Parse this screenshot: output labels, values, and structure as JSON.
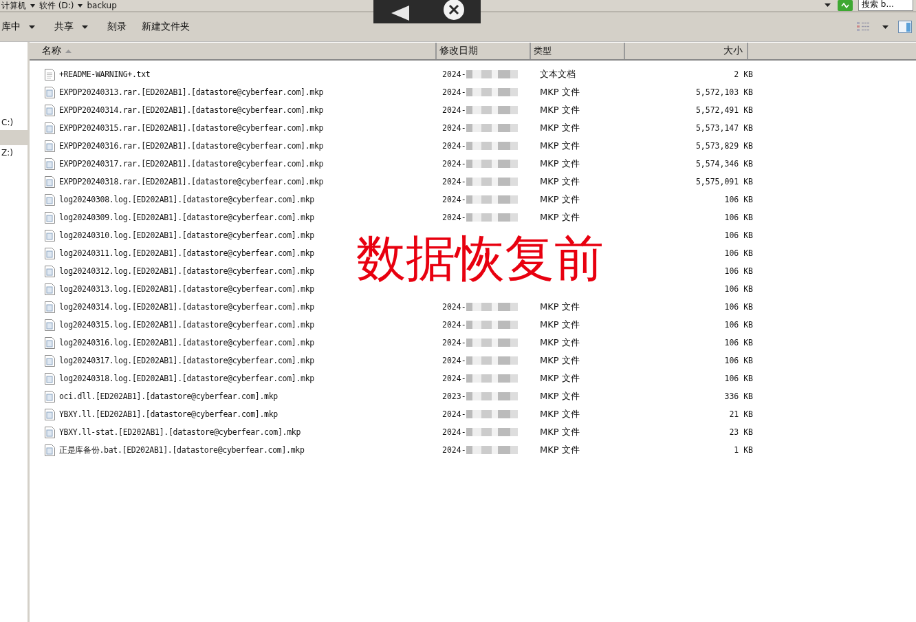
{
  "address_bar": {
    "crumbs": [
      "计算机",
      "软件 (D:)",
      "backup"
    ],
    "search": {
      "placeholder": "搜索 b..."
    }
  },
  "toolbar": {
    "items": [
      {
        "label": "库中",
        "dropdown": true
      },
      {
        "label": "共享",
        "dropdown": true
      },
      {
        "label": "刻录",
        "dropdown": false
      },
      {
        "label": "新建文件夹",
        "dropdown": false
      }
    ]
  },
  "sidebar": {
    "items": [
      {
        "label": "C:)",
        "selected": false
      },
      {
        "selected": true
      },
      {
        "label": "Z:)",
        "selected": false
      }
    ]
  },
  "table": {
    "columns": [
      {
        "label": "名称",
        "sorted": true
      },
      {
        "label": "修改日期",
        "sorted": false
      },
      {
        "label": "类型",
        "sorted": false
      },
      {
        "label": "大小",
        "sorted": false
      }
    ],
    "rows": [
      {
        "kind": "text",
        "name": "+README-WARNING+.txt",
        "date": "2024-",
        "type": "文本文档",
        "size": "2 KB"
      },
      {
        "kind": "file",
        "name": "EXPDP20240313.rar.[ED202AB1].[datastore@cyberfear.com].mkp",
        "date": "2024-",
        "type": "MKP 文件",
        "size": "5,572,103 KB"
      },
      {
        "kind": "file",
        "name": "EXPDP20240314.rar.[ED202AB1].[datastore@cyberfear.com].mkp",
        "date": "2024-",
        "type": "MKP 文件",
        "size": "5,572,491 KB"
      },
      {
        "kind": "file",
        "name": "EXPDP20240315.rar.[ED202AB1].[datastore@cyberfear.com].mkp",
        "date": "2024-",
        "type": "MKP 文件",
        "size": "5,573,147 KB"
      },
      {
        "kind": "file",
        "name": "EXPDP20240316.rar.[ED202AB1].[datastore@cyberfear.com].mkp",
        "date": "2024-",
        "type": "MKP 文件",
        "size": "5,573,829 KB"
      },
      {
        "kind": "file",
        "name": "EXPDP20240317.rar.[ED202AB1].[datastore@cyberfear.com].mkp",
        "date": "2024-",
        "type": "MKP 文件",
        "size": "5,574,346 KB"
      },
      {
        "kind": "file",
        "name": "EXPDP20240318.rar.[ED202AB1].[datastore@cyberfear.com].mkp",
        "date": "2024-",
        "type": "MKP 文件",
        "size": "5,575,091 KB"
      },
      {
        "kind": "file",
        "name": "log20240308.log.[ED202AB1].[datastore@cyberfear.com].mkp",
        "date": "2024-",
        "type": "MKP 文件",
        "size": "106 KB"
      },
      {
        "kind": "file",
        "name": "log20240309.log.[ED202AB1].[datastore@cyberfear.com].mkp",
        "date": "2024-",
        "type": "MKP 文件",
        "size": "106 KB"
      },
      {
        "kind": "file",
        "name": "log20240310.log.[ED202AB1].[datastore@cyberfear.com].mkp",
        "size": "106 KB"
      },
      {
        "kind": "file",
        "name": "log20240311.log.[ED202AB1].[datastore@cyberfear.com].mkp",
        "size": "106 KB"
      },
      {
        "kind": "file",
        "name": "log20240312.log.[ED202AB1].[datastore@cyberfear.com].mkp",
        "size": "106 KB"
      },
      {
        "kind": "file",
        "name": "log20240313.log.[ED202AB1].[datastore@cyberfear.com].mkp",
        "size": "106 KB"
      },
      {
        "kind": "file",
        "name": "log20240314.log.[ED202AB1].[datastore@cyberfear.com].mkp",
        "date": "2024-",
        "type": "MKP 文件",
        "size": "106 KB"
      },
      {
        "kind": "file",
        "name": "log20240315.log.[ED202AB1].[datastore@cyberfear.com].mkp",
        "date": "2024-",
        "type": "MKP 文件",
        "size": "106 KB"
      },
      {
        "kind": "file",
        "name": "log20240316.log.[ED202AB1].[datastore@cyberfear.com].mkp",
        "date": "2024-",
        "type": "MKP 文件",
        "size": "106 KB"
      },
      {
        "kind": "file",
        "name": "log20240317.log.[ED202AB1].[datastore@cyberfear.com].mkp",
        "date": "2024-",
        "type": "MKP 文件",
        "size": "106 KB"
      },
      {
        "kind": "file",
        "name": "log20240318.log.[ED202AB1].[datastore@cyberfear.com].mkp",
        "date": "2024-",
        "type": "MKP 文件",
        "size": "106 KB"
      },
      {
        "kind": "file",
        "name": "oci.dll.[ED202AB1].[datastore@cyberfear.com].mkp",
        "date": "2023-",
        "type": "MKP 文件",
        "size": "336 KB"
      },
      {
        "kind": "file",
        "name": "YBXY.ll.[ED202AB1].[datastore@cyberfear.com].mkp",
        "date": "2024-",
        "type": "MKP 文件",
        "size": "21 KB"
      },
      {
        "kind": "file",
        "name": "YBXY.ll-stat.[ED202AB1].[datastore@cyberfear.com].mkp",
        "date": "2024-",
        "type": "MKP 文件",
        "size": "23 KB"
      },
      {
        "kind": "file",
        "name": "正是库备份.bat.[ED202AB1].[datastore@cyberfear.com].mkp",
        "date": "2024-",
        "type": "MKP 文件",
        "size": "1 KB"
      }
    ]
  },
  "overlay_caption": "数据恢复前"
}
